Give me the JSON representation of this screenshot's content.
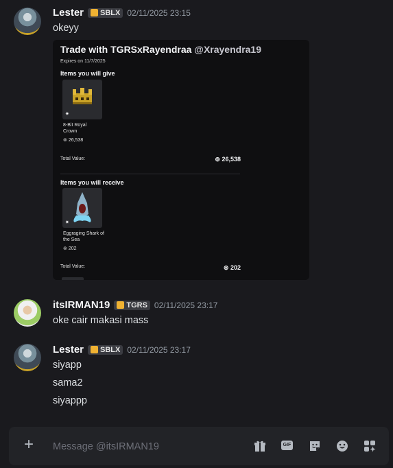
{
  "messages": [
    {
      "author": "Lester",
      "tag": "SBLX",
      "timestamp": "02/11/2025 23:15",
      "lines": [
        "okeyy"
      ]
    },
    {
      "author": "itsIRMAN19",
      "tag": "TGRS",
      "timestamp": "02/11/2025 23:17",
      "lines": [
        "oke cair makasi mass"
      ]
    },
    {
      "author": "Lester",
      "tag": "SBLX",
      "timestamp": "02/11/2025 23:17",
      "lines": [
        "siyapp",
        "sama2",
        "siyappp"
      ]
    }
  ],
  "trade_card": {
    "title": "Trade with TGRSxRayendraa",
    "handle": "@Xrayendra19",
    "expires": "Expires on 11/7/2025",
    "give_heading": "Items you will give",
    "give_item": {
      "name": "8-Bit Royal Crown",
      "value": "26,538"
    },
    "give_total_label": "Total Value:",
    "give_total": "26,538",
    "receive_heading": "Items you will receive",
    "receive_item": {
      "name": "Eggraging Shark of the Sea",
      "value": "202"
    },
    "receive_total_label": "Total Value:",
    "receive_total": "202"
  },
  "composer": {
    "placeholder": "Message @itsIRMAN19",
    "gif_label": "GIF"
  },
  "icons": {
    "add": "plus-icon",
    "gift": "gift-icon",
    "gif": "gif-icon",
    "sticker": "sticker-icon",
    "emoji": "emoji-icon",
    "apps": "apps-icon"
  }
}
